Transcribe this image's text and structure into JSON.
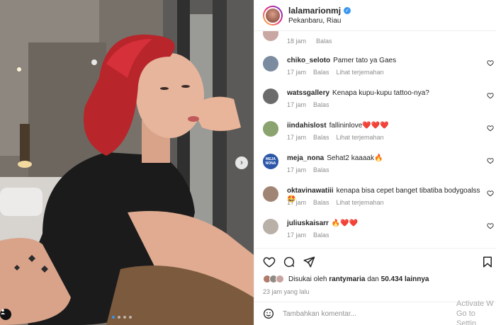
{
  "post": {
    "username": "lalamarionmj",
    "location": "Pekanbaru, Riau",
    "photo_dots": 4,
    "active_dot": 0
  },
  "comments_top_meta": {
    "time": "18 jam",
    "reply": "Balas"
  },
  "comments": [
    {
      "user": "chiko_seloto",
      "text": "Pamer tato ya Gaes",
      "time": "17 jam",
      "reply": "Balas",
      "translate": "Lihat terjemahan",
      "avatar_color": "#7b8ba0"
    },
    {
      "user": "watssgallery",
      "text": "Kenapa kupu-kupu tattoo-nya?",
      "time": "17 jam",
      "reply": "Balas",
      "translate": "",
      "avatar_color": "#6b6b6b"
    },
    {
      "user": "iindahislost",
      "text": "fallininlove❤️❤️❤️",
      "time": "17 jam",
      "reply": "Balas",
      "translate": "Lihat terjemahan",
      "avatar_color": "#8aa36f"
    },
    {
      "user": "meja_nona",
      "text": "Sehat2 kaaaak🔥",
      "time": "17 jam",
      "reply": "Balas",
      "translate": "",
      "avatar_color": "#2c57a8"
    },
    {
      "user": "oktavinawatiii",
      "text": "kenapa bisa cepet banget tibatiba bodygoalss🤩",
      "time": "17 jam",
      "reply": "Balas",
      "translate": "Lihat terjemahan",
      "avatar_color": "#a08575"
    },
    {
      "user": "juliuskaisarr",
      "text": "🔥❤️❤️",
      "time": "17 jam",
      "reply": "Balas",
      "translate": "",
      "avatar_color": "#b9b1a8"
    }
  ],
  "likes": {
    "prefix": "Disukai oleh",
    "user": "rantymaria",
    "conj": "dan",
    "count": "50.434 lainnya"
  },
  "time_ago": "23 jam yang lalu",
  "add_comment": {
    "placeholder": "Tambahkan komentar..."
  },
  "watermark": {
    "line1": "Activate W",
    "line2": "Go to Settin"
  },
  "meja_nona_avatar_text": "MEJA NONA",
  "colors": {
    "verified": "#3897f0",
    "meta": "#8e8e8e",
    "text": "#262626"
  }
}
